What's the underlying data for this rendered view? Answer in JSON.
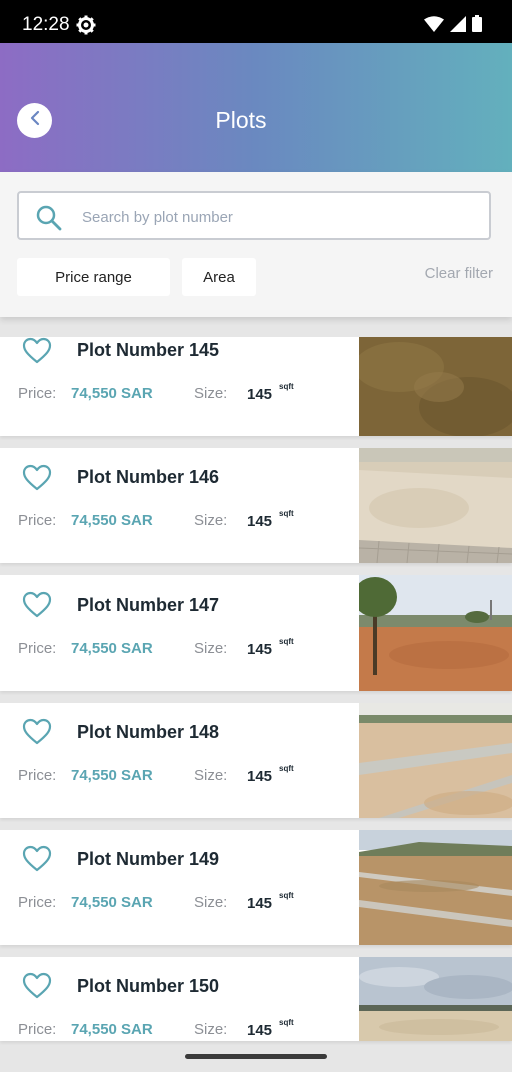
{
  "status_bar": {
    "time": "12:28"
  },
  "header": {
    "title": "Plots"
  },
  "filters": {
    "search_placeholder": "Search by plot number",
    "price_range_label": "Price range",
    "area_label": "Area",
    "clear_filter_label": "Clear filter"
  },
  "labels": {
    "price": "Price:",
    "size": "Size:",
    "unit": "sqft"
  },
  "plots": [
    {
      "title": "Plot Number 145",
      "price": "74,550 SAR",
      "size": "145"
    },
    {
      "title": "Plot Number 146",
      "price": "74,550 SAR",
      "size": "145"
    },
    {
      "title": "Plot Number 147",
      "price": "74,550 SAR",
      "size": "145"
    },
    {
      "title": "Plot Number 148",
      "price": "74,550 SAR",
      "size": "145"
    },
    {
      "title": "Plot Number 149",
      "price": "74,550 SAR",
      "size": "145"
    },
    {
      "title": "Plot Number 150",
      "price": "74,550 SAR",
      "size": "145"
    }
  ],
  "colors": {
    "accent": "#5aa5b2",
    "header_start": "#8d6cc4",
    "header_end": "#63b0bd"
  }
}
